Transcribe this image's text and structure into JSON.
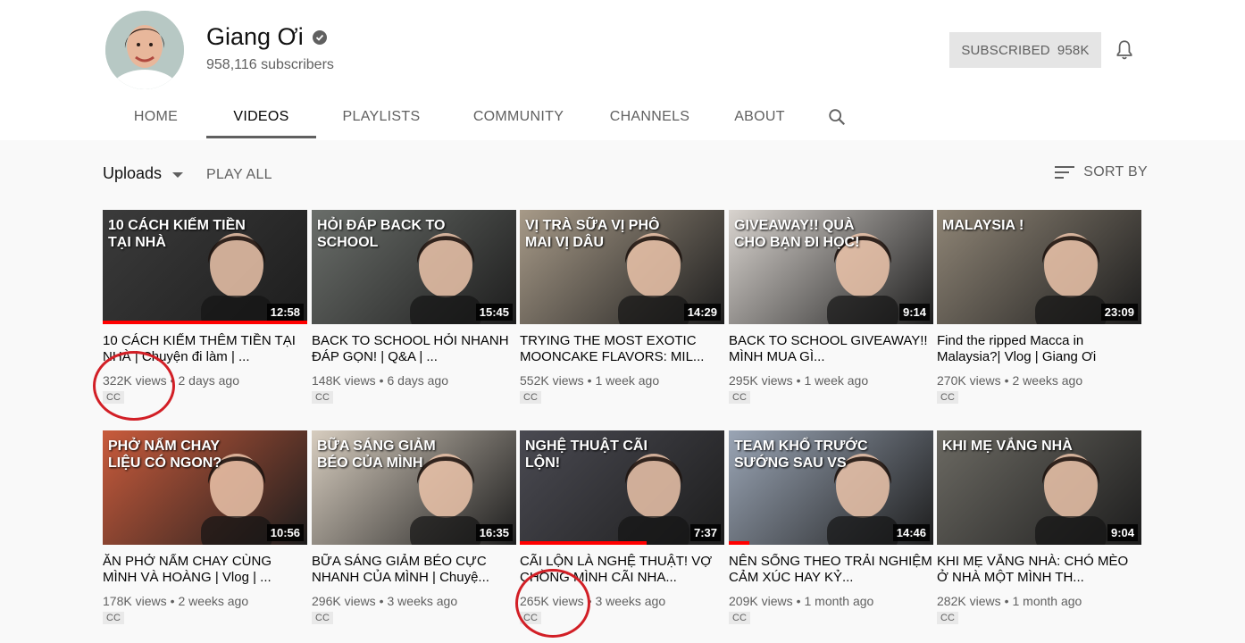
{
  "channel": {
    "name": "Giang Ơi",
    "subscribers": "958,116 subscribers",
    "subscribe_label": "SUBSCRIBED",
    "subscribe_count": "958K"
  },
  "tabs": [
    "HOME",
    "VIDEOS",
    "PLAYLISTS",
    "COMMUNITY",
    "CHANNELS",
    "ABOUT"
  ],
  "active_tab": "VIDEOS",
  "toolbar": {
    "uploads": "Uploads",
    "play_all": "PLAY ALL",
    "sort_by": "SORT BY"
  },
  "cc_label": "CC",
  "videos": [
    {
      "title": "10 CÁCH KIẾM THÊM TIỀN TẠI NHÀ | Chuyện đi làm | ...",
      "views": "322K views",
      "age": "2 days ago",
      "duration": "12:58",
      "thumb_text": "10 CÁCH KIẾM TIỀN TẠI NHÀ",
      "progress": 1.0
    },
    {
      "title": "BACK TO SCHOOL HỎI NHANH ĐÁP GỌN! | Q&A | ...",
      "views": "148K views",
      "age": "6 days ago",
      "duration": "15:45",
      "thumb_text": "HỎI ĐÁP BACK TO SCHOOL"
    },
    {
      "title": "TRYING THE MOST EXOTIC MOONCAKE FLAVORS: MIL...",
      "views": "552K views",
      "age": "1 week ago",
      "duration": "14:29",
      "thumb_text": "VỊ TRÀ SỮA VỊ PHÔ MAI VỊ DÂU"
    },
    {
      "title": "BACK TO SCHOOL GIVEAWAY!! MÌNH MUA GÌ...",
      "views": "295K views",
      "age": "1 week ago",
      "duration": "9:14",
      "thumb_text": "GIVEAWAY!! QUÀ CHO BẠN ĐI HỌC!"
    },
    {
      "title": "Find the ripped Macca in Malaysia?| Vlog | Giang Ơi",
      "views": "270K views",
      "age": "2 weeks ago",
      "duration": "23:09",
      "thumb_text": "MALAYSIA !"
    },
    {
      "title": "ĂN PHỞ NẤM CHAY CÙNG MÌNH VÀ HOÀNG | Vlog | ...",
      "views": "178K views",
      "age": "2 weeks ago",
      "duration": "10:56",
      "thumb_text": "PHỞ NẤM CHAY LIỆU CÓ NGON?"
    },
    {
      "title": "BỮA SÁNG GIẢM BÉO CỰC NHANH CỦA MÌNH | Chuyệ...",
      "views": "296K views",
      "age": "3 weeks ago",
      "duration": "16:35",
      "thumb_text": "BỮA SÁNG GIẢM BÉO CỦA MÌNH"
    },
    {
      "title": "CÃI LỘN LÀ NGHỆ THUẬT! VỢ CHỒNG MÌNH CÃI NHA...",
      "views": "265K views",
      "age": "3 weeks ago",
      "duration": "7:37",
      "thumb_text": "NGHỆ THUẬT CÃI LỘN!",
      "progress": 0.62
    },
    {
      "title": "NÊN SỐNG THEO TRẢI NGHIỆM CẢM XÚC HAY KỶ...",
      "views": "209K views",
      "age": "1 month ago",
      "duration": "14:46",
      "thumb_text": "TEAM KHỔ TRƯỚC SƯỚNG SAU VS",
      "progress": 0.1
    },
    {
      "title": "KHI MẸ VẮNG NHÀ: CHÓ MÈO Ở NHÀ MỘT MÌNH TH...",
      "views": "282K views",
      "age": "1 month ago",
      "duration": "9:04",
      "thumb_text": "KHI MẸ VẮNG NHÀ"
    }
  ],
  "colors": {
    "accent": "#ff0000",
    "annotation": "#d21f26",
    "thumbs": [
      "#3b3b3b",
      "#6a6e6a",
      "#a79a88",
      "#d9d4cf",
      "#8f8576",
      "#c95b3c",
      "#d7cdbf",
      "#4a4a52",
      "#9aa5b5",
      "#6c6a63"
    ]
  }
}
